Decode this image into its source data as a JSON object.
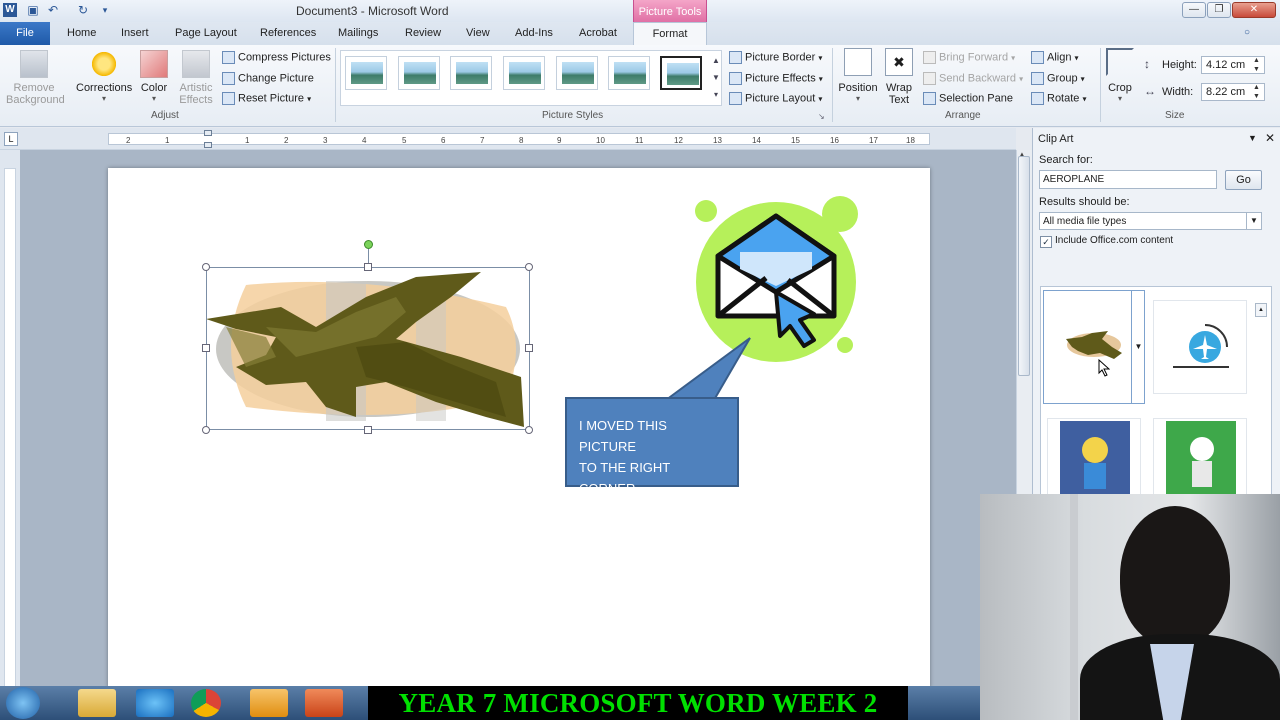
{
  "window": {
    "title": "Document3 - Microsoft Word",
    "contextual_tab_group": "Picture Tools"
  },
  "tabs": [
    "File",
    "Home",
    "Insert",
    "Page Layout",
    "References",
    "Mailings",
    "Review",
    "View",
    "Add-Ins",
    "Acrobat",
    "Format"
  ],
  "ribbon": {
    "adjust": {
      "remove_background": [
        "Remove",
        "Background"
      ],
      "corrections": "Corrections",
      "color": "Color",
      "artistic_effects": [
        "Artistic",
        "Effects"
      ],
      "compress": "Compress Pictures",
      "change": "Change Picture",
      "reset": "Reset Picture",
      "group_label": "Adjust"
    },
    "picture_styles": {
      "border": "Picture Border",
      "effects": "Picture Effects",
      "layout": "Picture Layout",
      "group_label": "Picture Styles"
    },
    "arrange": {
      "position": "Position",
      "wrap_text": [
        "Wrap",
        "Text"
      ],
      "bring_forward": "Bring Forward",
      "send_backward": "Send Backward",
      "selection_pane": "Selection Pane",
      "align": "Align",
      "group": "Group",
      "rotate": "Rotate",
      "group_label": "Arrange"
    },
    "size": {
      "crop": "Crop",
      "height_label": "Height:",
      "height_value": "4.12 cm",
      "width_label": "Width:",
      "width_value": "8.22 cm",
      "group_label": "Size"
    }
  },
  "ruler_numbers": [
    "2",
    "1",
    "1",
    "2",
    "3",
    "4",
    "5",
    "6",
    "7",
    "8",
    "9",
    "10",
    "11",
    "12",
    "13",
    "14",
    "15",
    "16",
    "17",
    "18"
  ],
  "document": {
    "callout_lines": [
      "I MOVED THIS PICTURE",
      "TO THE RIGHT CORNER"
    ]
  },
  "clip_art": {
    "title": "Clip Art",
    "search_label": "Search for:",
    "search_value": "AEROPLANE",
    "go_button": "Go",
    "results_label": "Results should be:",
    "results_value": "All media file types",
    "include_office": "Include Office.com content",
    "include_office_checked": true
  },
  "banner": "YEAR 7 MICROSOFT WORD WEEK 2",
  "colors": {
    "callout_fill": "#4f81bd",
    "banner_text": "#00e000",
    "file_tab": "#2a66b5",
    "picture_tools": "#e37cb0"
  }
}
